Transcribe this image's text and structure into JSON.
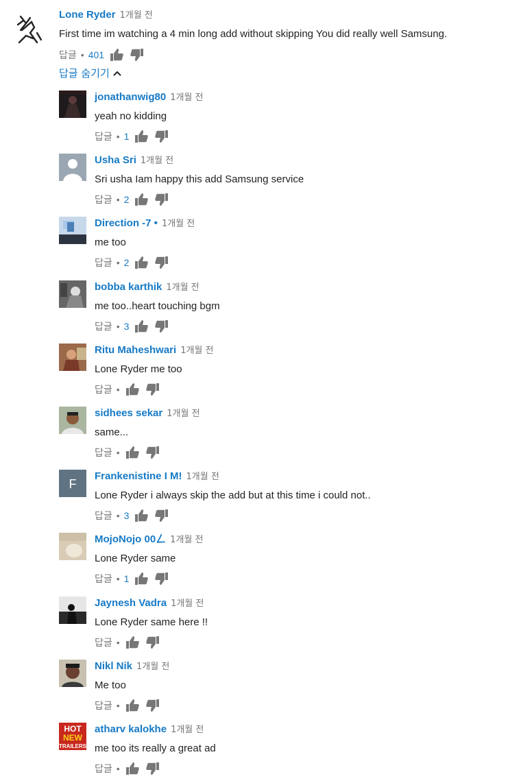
{
  "top_comment": {
    "author": "Lone Ryder",
    "time": "1개월 전",
    "text": "First time im watching a 4 min long add without skipping You did really well Samsung.",
    "reply_label": "답글",
    "likes": "401"
  },
  "hide_replies_label": "답글 숨기기",
  "replies": [
    {
      "author": "jonathanwig80",
      "time": "1개월 전",
      "text": "yeah no kidding",
      "reply_label": "답글",
      "likes": "1",
      "avatar": "dark-photo"
    },
    {
      "author": "Usha Sri",
      "time": "1개월 전",
      "text": "Sri usha Iam happy this add Samsung service",
      "reply_label": "답글",
      "likes": "2",
      "avatar": "default-person"
    },
    {
      "author": "Direction -7 •",
      "time": "1개월 전",
      "text": "me too",
      "reply_label": "답글",
      "likes": "2",
      "avatar": "blue-photo"
    },
    {
      "author": "bobba karthik",
      "time": "1개월 전",
      "text": "me too..heart touching bgm",
      "reply_label": "답글",
      "likes": "3",
      "avatar": "bw-photo"
    },
    {
      "author": "Ritu Maheshwari",
      "time": "1개월 전",
      "text": "Lone Ryder me too",
      "reply_label": "답글",
      "likes": "",
      "avatar": "warm-photo"
    },
    {
      "author": "sidhees sekar",
      "time": "1개월 전",
      "text": "same...",
      "reply_label": "답글",
      "likes": "",
      "avatar": "face-photo"
    },
    {
      "author": "Frankenistine I M!",
      "time": "1개월 전",
      "text": "Lone Ryder i always skip the add but at this time i could not..",
      "reply_label": "답글",
      "likes": "3",
      "avatar": "letter-F"
    },
    {
      "author": "MojoNojo 00ㄥ",
      "time": "1개월 전",
      "text": "Lone Ryder same",
      "reply_label": "답글",
      "likes": "1",
      "avatar": "beige-photo"
    },
    {
      "author": "Jaynesh Vadra",
      "time": "1개월 전",
      "text": "Lone Ryder same here !!",
      "reply_label": "답글",
      "likes": "",
      "avatar": "silhouette-photo"
    },
    {
      "author": "Nikl Nik",
      "time": "1개월 전",
      "text": "Me too",
      "reply_label": "답글",
      "likes": "",
      "avatar": "face-photo-2"
    },
    {
      "author": "atharv kalokhe",
      "time": "1개월 전",
      "text": "me too its really a great ad",
      "reply_label": "답글",
      "likes": "",
      "avatar": "hot-new-trailers"
    }
  ],
  "avatar_letter": "F",
  "trailer_logo": {
    "line1": "HOT",
    "line2": "NEW",
    "line3": "TRAILERS"
  },
  "colors": {
    "link": "#167ac6",
    "meta": "#767676",
    "icon": "#777777",
    "text": "#222222"
  }
}
